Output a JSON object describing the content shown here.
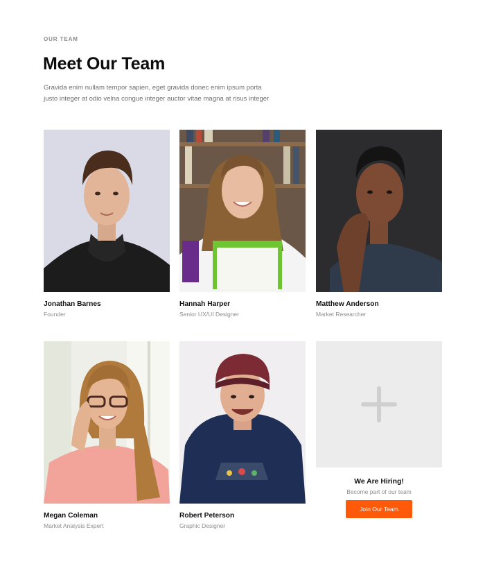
{
  "section": {
    "eyebrow": "OUR TEAM",
    "title": "Meet Our Team",
    "description": "Gravida enim nullam tempor sapien, eget gravida donec enim ipsum porta justo integer at odio velna congue integer auctor vitae magna at risus integer"
  },
  "members": [
    {
      "name": "Jonathan Barnes",
      "role": "Founder"
    },
    {
      "name": "Hannah Harper",
      "role": "Senior UX/UI Designer"
    },
    {
      "name": "Matthew Anderson",
      "role": "Market Researcher"
    },
    {
      "name": "Megan Coleman",
      "role": "Market Analysis Expert"
    },
    {
      "name": "Robert Peterson",
      "role": "Graphic Designer"
    }
  ],
  "hiring": {
    "icon": "plus-icon",
    "title": "We Are Hiring!",
    "subtitle": "Become part of our team",
    "button_label": "Join Our Team"
  },
  "colors": {
    "accent": "#ff5a0a",
    "placeholder_bg": "#ececec"
  }
}
